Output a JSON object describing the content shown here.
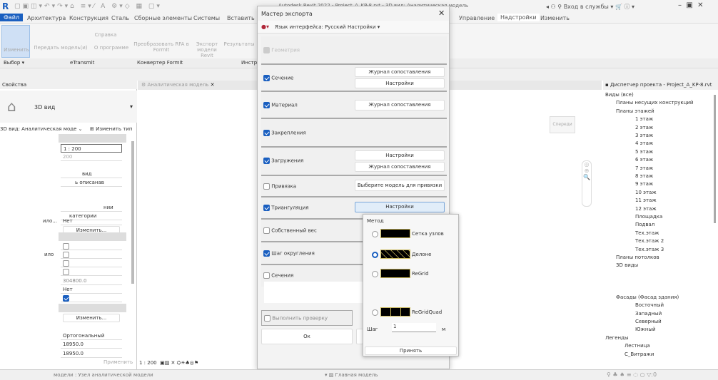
{
  "window": {
    "title": "Autodesk Revit 2022 - Project_A_KP-8.rvt - 3D вид: Аналитическая модель",
    "signin": "Вход в службы"
  },
  "tabs": [
    "Файл",
    "Архитектура",
    "Конструкция",
    "Сталь",
    "Сборные элементы",
    "Системы",
    "Вставить",
    "Управление",
    "Надстройки",
    "Изменить"
  ],
  "ribbon": {
    "modify": "Изменить",
    "send_model": "Передать модель(и)",
    "help": "Справка",
    "about": "О программе",
    "convert": "Преобразовать RFA в FormIt",
    "export": "Экспорт модели Revit",
    "results": "Результаты",
    "select": "Выбор",
    "etransmit": "eTransmit",
    "formit": "Конвертер FormIt",
    "tools": "Инстр"
  },
  "properties": {
    "title": "Свойства",
    "type": "3D вид",
    "instance": "3D вид: Аналитическая моде",
    "edit_type": "Изменить тип",
    "scale": "1 : 200",
    "scale2": "200",
    "v1": "вид",
    "v2": "ь описанав",
    "v3": "нии",
    "v4": "категории",
    "v5lbl": "ило...",
    "v5": "Нет",
    "edit1": "Изменить...",
    "v6lbl": "ило",
    "num": "304800.0",
    "no": "Нет",
    "edit2": "Изменить...",
    "ortho": "Ортогональный",
    "n1": "18950.0",
    "n2": "18950.0",
    "apply": "Применить"
  },
  "view_tab": "Аналитическая модель",
  "viewcube": "Спереди",
  "view_scale": "1 : 200",
  "dialog": {
    "title": "Мастер экспорта",
    "language": "Язык интерфейса: Русский",
    "settings_menu": "Настройки",
    "rows": [
      {
        "label": "Геометрия",
        "checked": true,
        "disabled": true
      },
      {
        "label": "Сечение",
        "checked": true,
        "b1": "Журнал сопоставления",
        "b2": "Настройки"
      },
      {
        "label": "Материал",
        "checked": true,
        "b1": "Журнал сопоставления"
      },
      {
        "label": "Закрепления",
        "checked": true
      },
      {
        "label": "Загружения",
        "checked": true,
        "b1": "Настройки",
        "b2": "Журнал сопоставления"
      },
      {
        "label": "Привязка",
        "checked": false,
        "b1": "Выберите модель для привязки"
      },
      {
        "label": "Триангуляция",
        "checked": true,
        "b1": "Настройки"
      },
      {
        "label": "Собственный вес",
        "checked": false
      },
      {
        "label": "Шаг округления",
        "checked": true
      },
      {
        "label": "Сечения",
        "checked": false
      }
    ],
    "bottom_check": "Выполнить проверку",
    "ok": "Ок"
  },
  "popup": {
    "method": "Метод",
    "options": [
      {
        "label": "Сетка узлов",
        "selected": false
      },
      {
        "label": "Делоне",
        "selected": true
      },
      {
        "label": "ReGrid",
        "selected": false
      },
      {
        "label": "ReGridQuad",
        "selected": false
      }
    ],
    "step_label": "Шаг",
    "step_value": "1",
    "unit": "м",
    "accept": "Принять"
  },
  "browser": {
    "title": "Диспетчер проекта - Project_A_KP-8.rvt",
    "views": "Виды (все)",
    "structural_plans": "Планы несущих конструкций",
    "floor_plans": "Планы этажей",
    "floors": [
      "1 этаж",
      "2 этаж",
      "3 этаж",
      "4 этаж",
      "5 этаж",
      "6 этаж",
      "7 этаж",
      "8 этаж",
      "9 этаж",
      "10 этаж",
      "11 этаж",
      "12 этаж",
      "Площадка",
      "Подвал",
      "Тех.этаж",
      "Тех.этаж 2",
      "Тех.этаж 3"
    ],
    "ceiling": "Планы потолков",
    "views3d": "3D виды",
    "facades": "Фасады (Фасад здания)",
    "facade_items": [
      "Восточный",
      "Западный",
      "Северный",
      "Южный"
    ],
    "legends": "Легенды",
    "legend_items": [
      "Лестница",
      "С_Витражи"
    ]
  },
  "status": {
    "left": "модели : Узел аналитической модели",
    "model": "Главная модель",
    "filter": ":0"
  }
}
